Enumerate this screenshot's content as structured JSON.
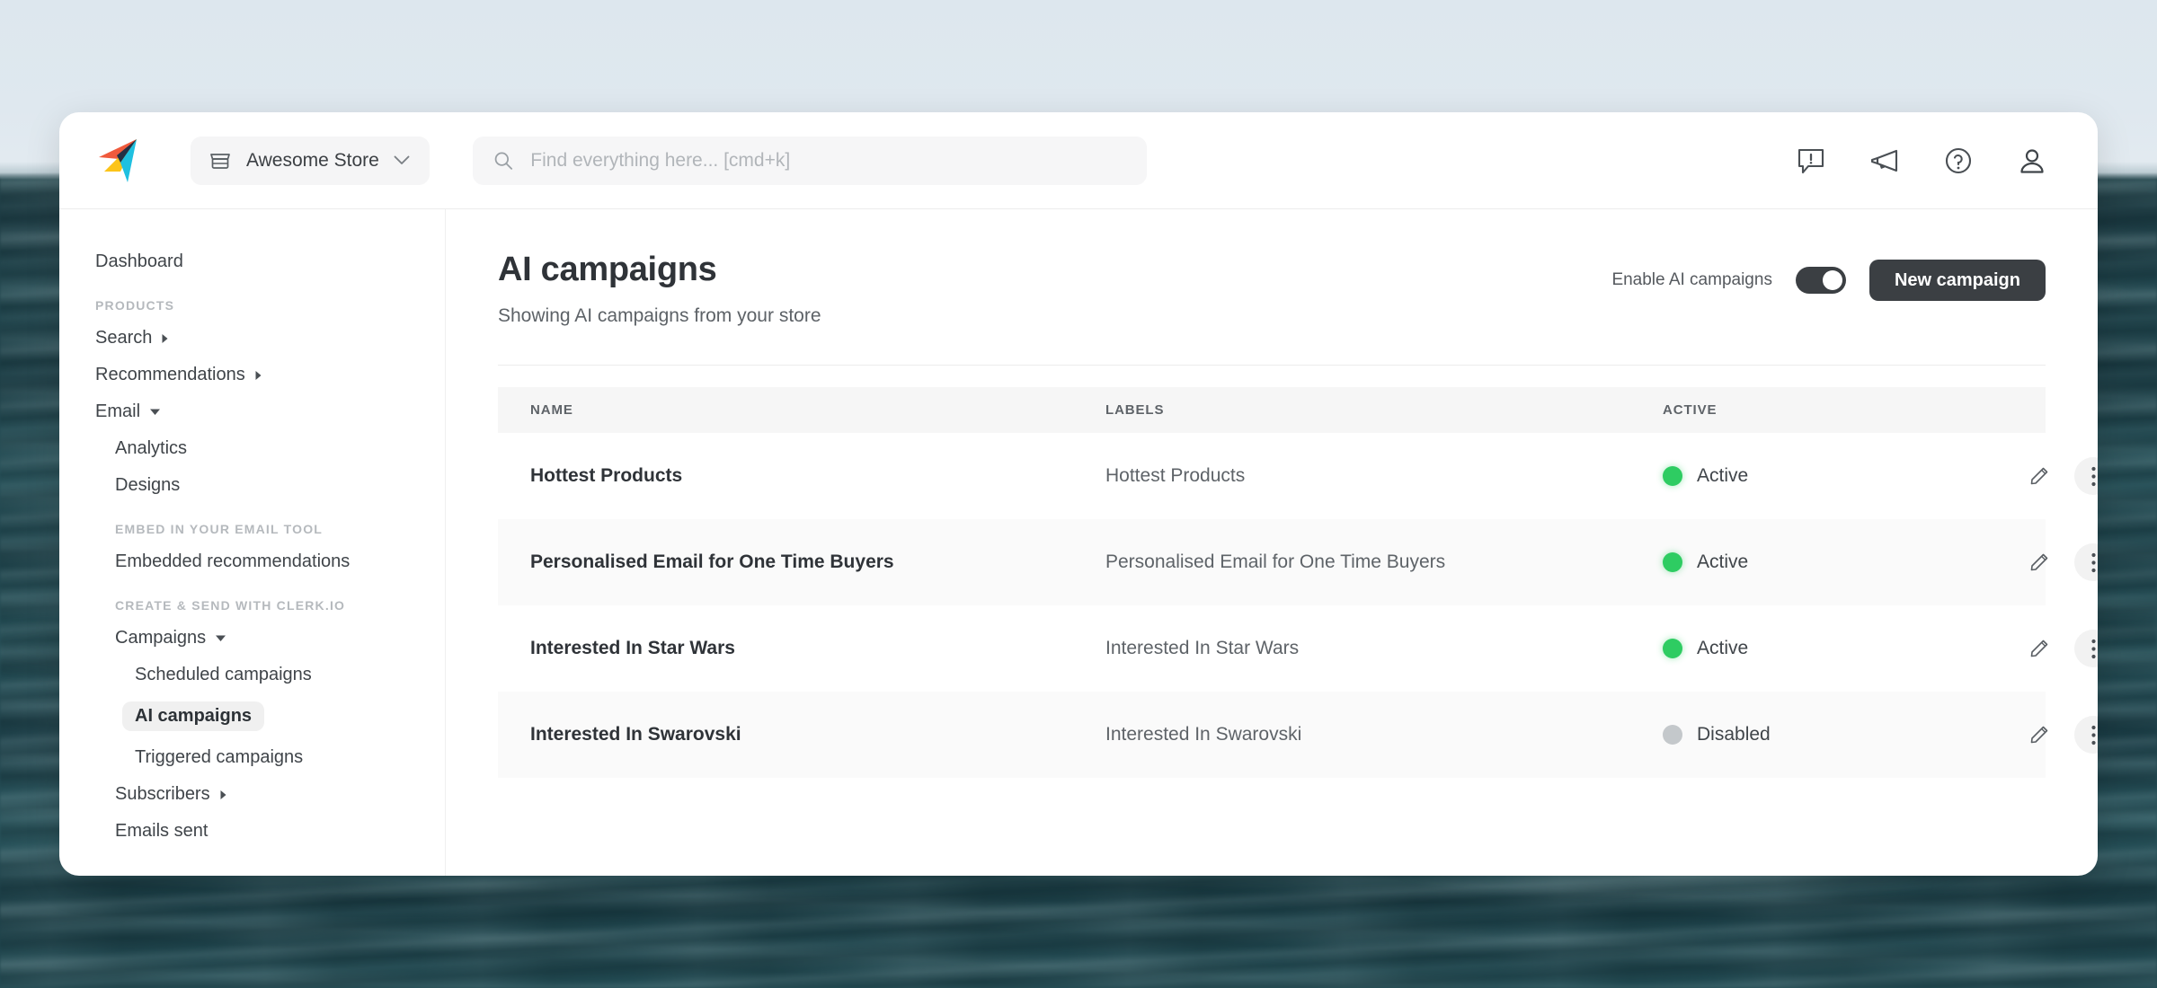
{
  "topbar": {
    "logo_icon": "clerkio-paperplane-logo",
    "store_selector": {
      "icon": "store-icon",
      "name": "Awesome Store",
      "chevron_icon": "chevron-down-icon"
    },
    "search": {
      "icon": "search-icon",
      "value": "",
      "placeholder": "Find everything here... [cmd+k]"
    },
    "actions": [
      {
        "icon": "alert-message-icon"
      },
      {
        "icon": "megaphone-announcement-icon"
      },
      {
        "icon": "help-circle-icon"
      },
      {
        "icon": "user-account-icon"
      }
    ]
  },
  "sidebar": {
    "dashboard_label": "Dashboard",
    "products_section": "PRODUCTS",
    "search_label": "Search",
    "recommendations_label": "Recommendations",
    "email_label": "Email",
    "analytics_label": "Analytics",
    "designs_label": "Designs",
    "embed_section": "EMBED IN YOUR EMAIL TOOL",
    "embedded_recommendations_label": "Embedded recommendations",
    "create_send_section": "CREATE & SEND WITH CLERK.IO",
    "campaigns_label": "Campaigns",
    "scheduled_campaigns_label": "Scheduled campaigns",
    "ai_campaigns_label": "AI campaigns",
    "triggered_campaigns_label": "Triggered campaigns",
    "subscribers_label": "Subscribers",
    "emails_sent_label": "Emails sent"
  },
  "page": {
    "title": "AI campaigns",
    "subtitle": "Showing AI campaigns from your store",
    "toggle_label": "Enable AI campaigns",
    "toggle_on": true,
    "new_campaign_label": "New campaign"
  },
  "table": {
    "columns": {
      "name": "NAME",
      "labels": "LABELS",
      "active": "ACTIVE"
    },
    "rows": [
      {
        "name": "Hottest Products",
        "label": "Hottest Products",
        "status": "Active",
        "active": true
      },
      {
        "name": "Personalised Email for One Time Buyers",
        "label": "Personalised Email for One Time Buyers",
        "status": "Active",
        "active": true
      },
      {
        "name": "Interested In Star Wars",
        "label": "Interested In Star Wars",
        "status": "Active",
        "active": true
      },
      {
        "name": "Interested In Swarovski",
        "label": "Interested In Swarovski",
        "status": "Disabled",
        "active": false
      }
    ]
  },
  "colors": {
    "accent_dark": "#3b3f43",
    "status_active": "#2ecc62",
    "status_disabled": "#c4c8cb"
  }
}
